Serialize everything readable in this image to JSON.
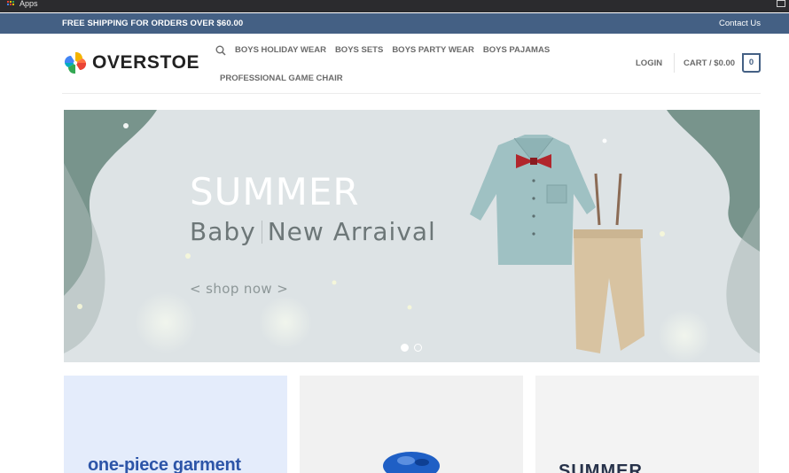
{
  "browser": {
    "bookmarks_label": "Apps"
  },
  "topbar": {
    "promo": "FREE SHIPPING FOR ORDERS OVER $60.00",
    "contact": "Contact Us"
  },
  "header": {
    "logo_text": "OVERSTOE",
    "nav": [
      {
        "label": "BOYS HOLIDAY WEAR"
      },
      {
        "label": "BOYS SETS"
      },
      {
        "label": "BOYS PARTY WEAR"
      },
      {
        "label": "BOYS PAJAMAS"
      },
      {
        "label": "PROFESSIONAL GAME CHAIR"
      }
    ],
    "login": "LOGIN",
    "cart": "CART / $0.00",
    "cart_count": "0"
  },
  "hero": {
    "title": "SUMMER",
    "subtitle_left": "Baby",
    "subtitle_right": "New Arraival",
    "cta": "< shop now >",
    "slides_total": 2,
    "slide_active": 1
  },
  "cards": [
    {
      "text": "one-piece garment"
    },
    {
      "text": ""
    },
    {
      "text": "SUMMER"
    }
  ],
  "colors": {
    "brand": "#446084",
    "hero_bg": "#dfe4e6",
    "leaf": "#6f8d84"
  }
}
